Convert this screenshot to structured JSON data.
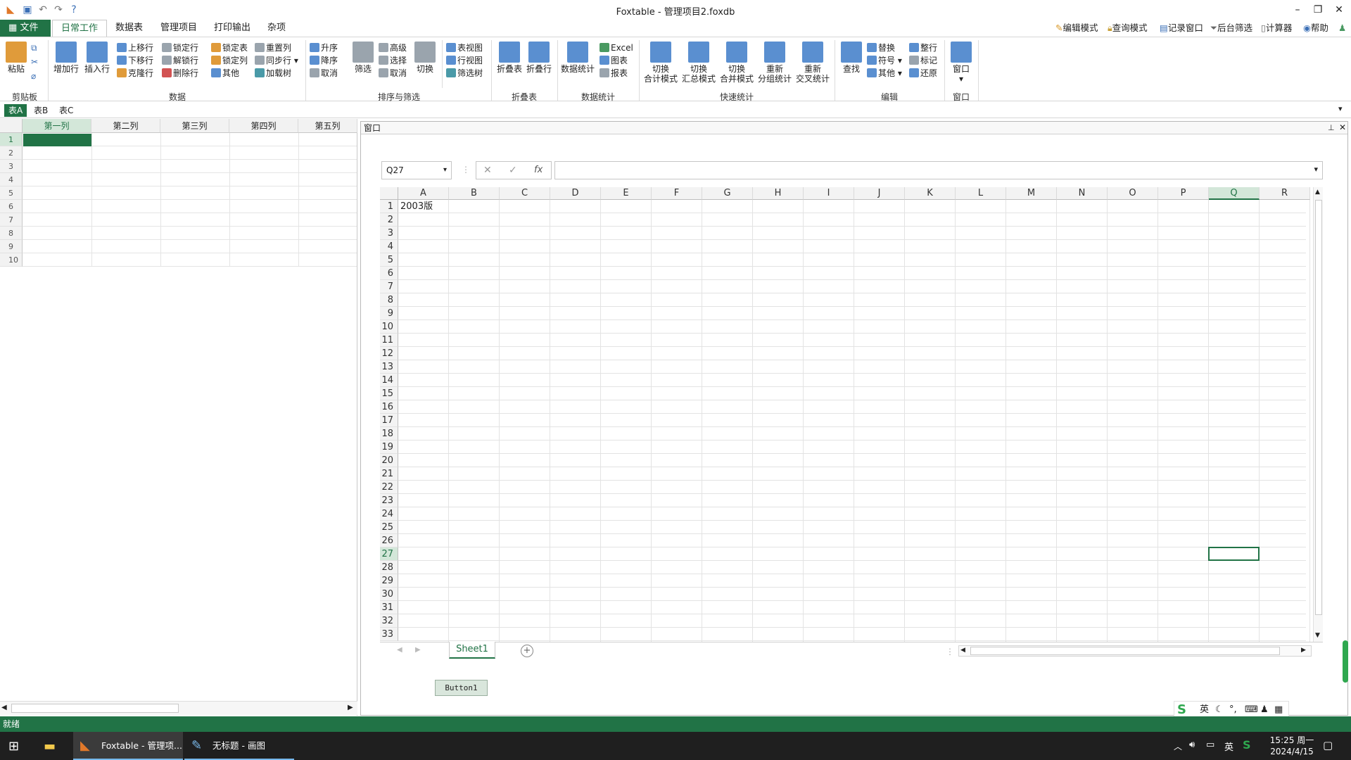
{
  "window": {
    "title": "Foxtable - 管理项目2.foxdb"
  },
  "menu_tabs": [
    "文件",
    "日常工作",
    "数据表",
    "管理项目",
    "打印输出",
    "杂项"
  ],
  "right_tools": [
    "编辑模式",
    "查询模式",
    "记录窗口",
    "后台筛选",
    "计算器",
    "帮助"
  ],
  "ribbon": {
    "clipboard": {
      "label": "剪贴板",
      "paste": "粘贴"
    },
    "data": {
      "label": "数据",
      "add_row": "增加行",
      "insert_row": "插入行",
      "col1": [
        "上移行",
        "下移行",
        "克隆行"
      ],
      "col2": [
        "锁定行",
        "解锁行",
        "删除行"
      ],
      "col3": [
        "锁定表",
        "锁定列",
        "其他"
      ],
      "col4": [
        "重置列",
        "同步行",
        "加载树"
      ]
    },
    "sort_filter": {
      "label": "排序与筛选",
      "sort": [
        "升序",
        "降序",
        "取消"
      ],
      "filter": "筛选",
      "adv": [
        "高级",
        "选择",
        "取消"
      ],
      "switch": "切换",
      "views": [
        "表视图",
        "行视图",
        "筛选树"
      ]
    },
    "fold": {
      "label": "折叠表",
      "table": "折叠表",
      "row": "折叠行"
    },
    "stats": {
      "label": "数据统计",
      "main": "数据统计",
      "items": [
        "Excel",
        "图表",
        "报表"
      ]
    },
    "quick_stats": {
      "label": "快速统计",
      "items": [
        [
          "切换",
          "合计模式"
        ],
        [
          "切换",
          "汇总模式"
        ],
        [
          "切换",
          "合并模式"
        ],
        [
          "重新",
          "分组统计"
        ],
        [
          "重新",
          "交叉统计"
        ]
      ]
    },
    "edit": {
      "label": "编辑",
      "find": "查找",
      "col1": [
        "替换",
        "符号",
        "其他"
      ],
      "col2": [
        "整行",
        "标记",
        "还原"
      ]
    },
    "window": {
      "label": "窗口",
      "main": "窗口"
    }
  },
  "table_tabs": [
    "表A",
    "表B",
    "表C"
  ],
  "left_grid": {
    "columns": [
      "第一列",
      "第二列",
      "第三列",
      "第四列",
      "第五列"
    ],
    "rows": [
      "1",
      "2",
      "3",
      "4",
      "5",
      "6",
      "7",
      "8",
      "9",
      "10"
    ]
  },
  "panel": {
    "title": "窗口"
  },
  "spreadsheet": {
    "name_box": "Q27",
    "fx": "fx",
    "columns": [
      "A",
      "B",
      "C",
      "D",
      "E",
      "F",
      "G",
      "H",
      "I",
      "J",
      "K",
      "L",
      "M",
      "N",
      "O",
      "P",
      "Q",
      "R"
    ],
    "selected_column": "Q",
    "selected_row": 27,
    "cell_a1": "2003版",
    "sheet_tab": "Sheet1",
    "row_count": 33
  },
  "button1": "Button1",
  "status": "就绪",
  "taskbar": {
    "items": [
      "Foxtable - 管理项...",
      "无标题 - 画图"
    ],
    "lang": "英",
    "time": "15:25 周一",
    "date": "2024/4/15"
  },
  "ime": {
    "lang": "英"
  },
  "colors": {
    "accent": "#217346",
    "taskbar": "#1f1f1f"
  }
}
